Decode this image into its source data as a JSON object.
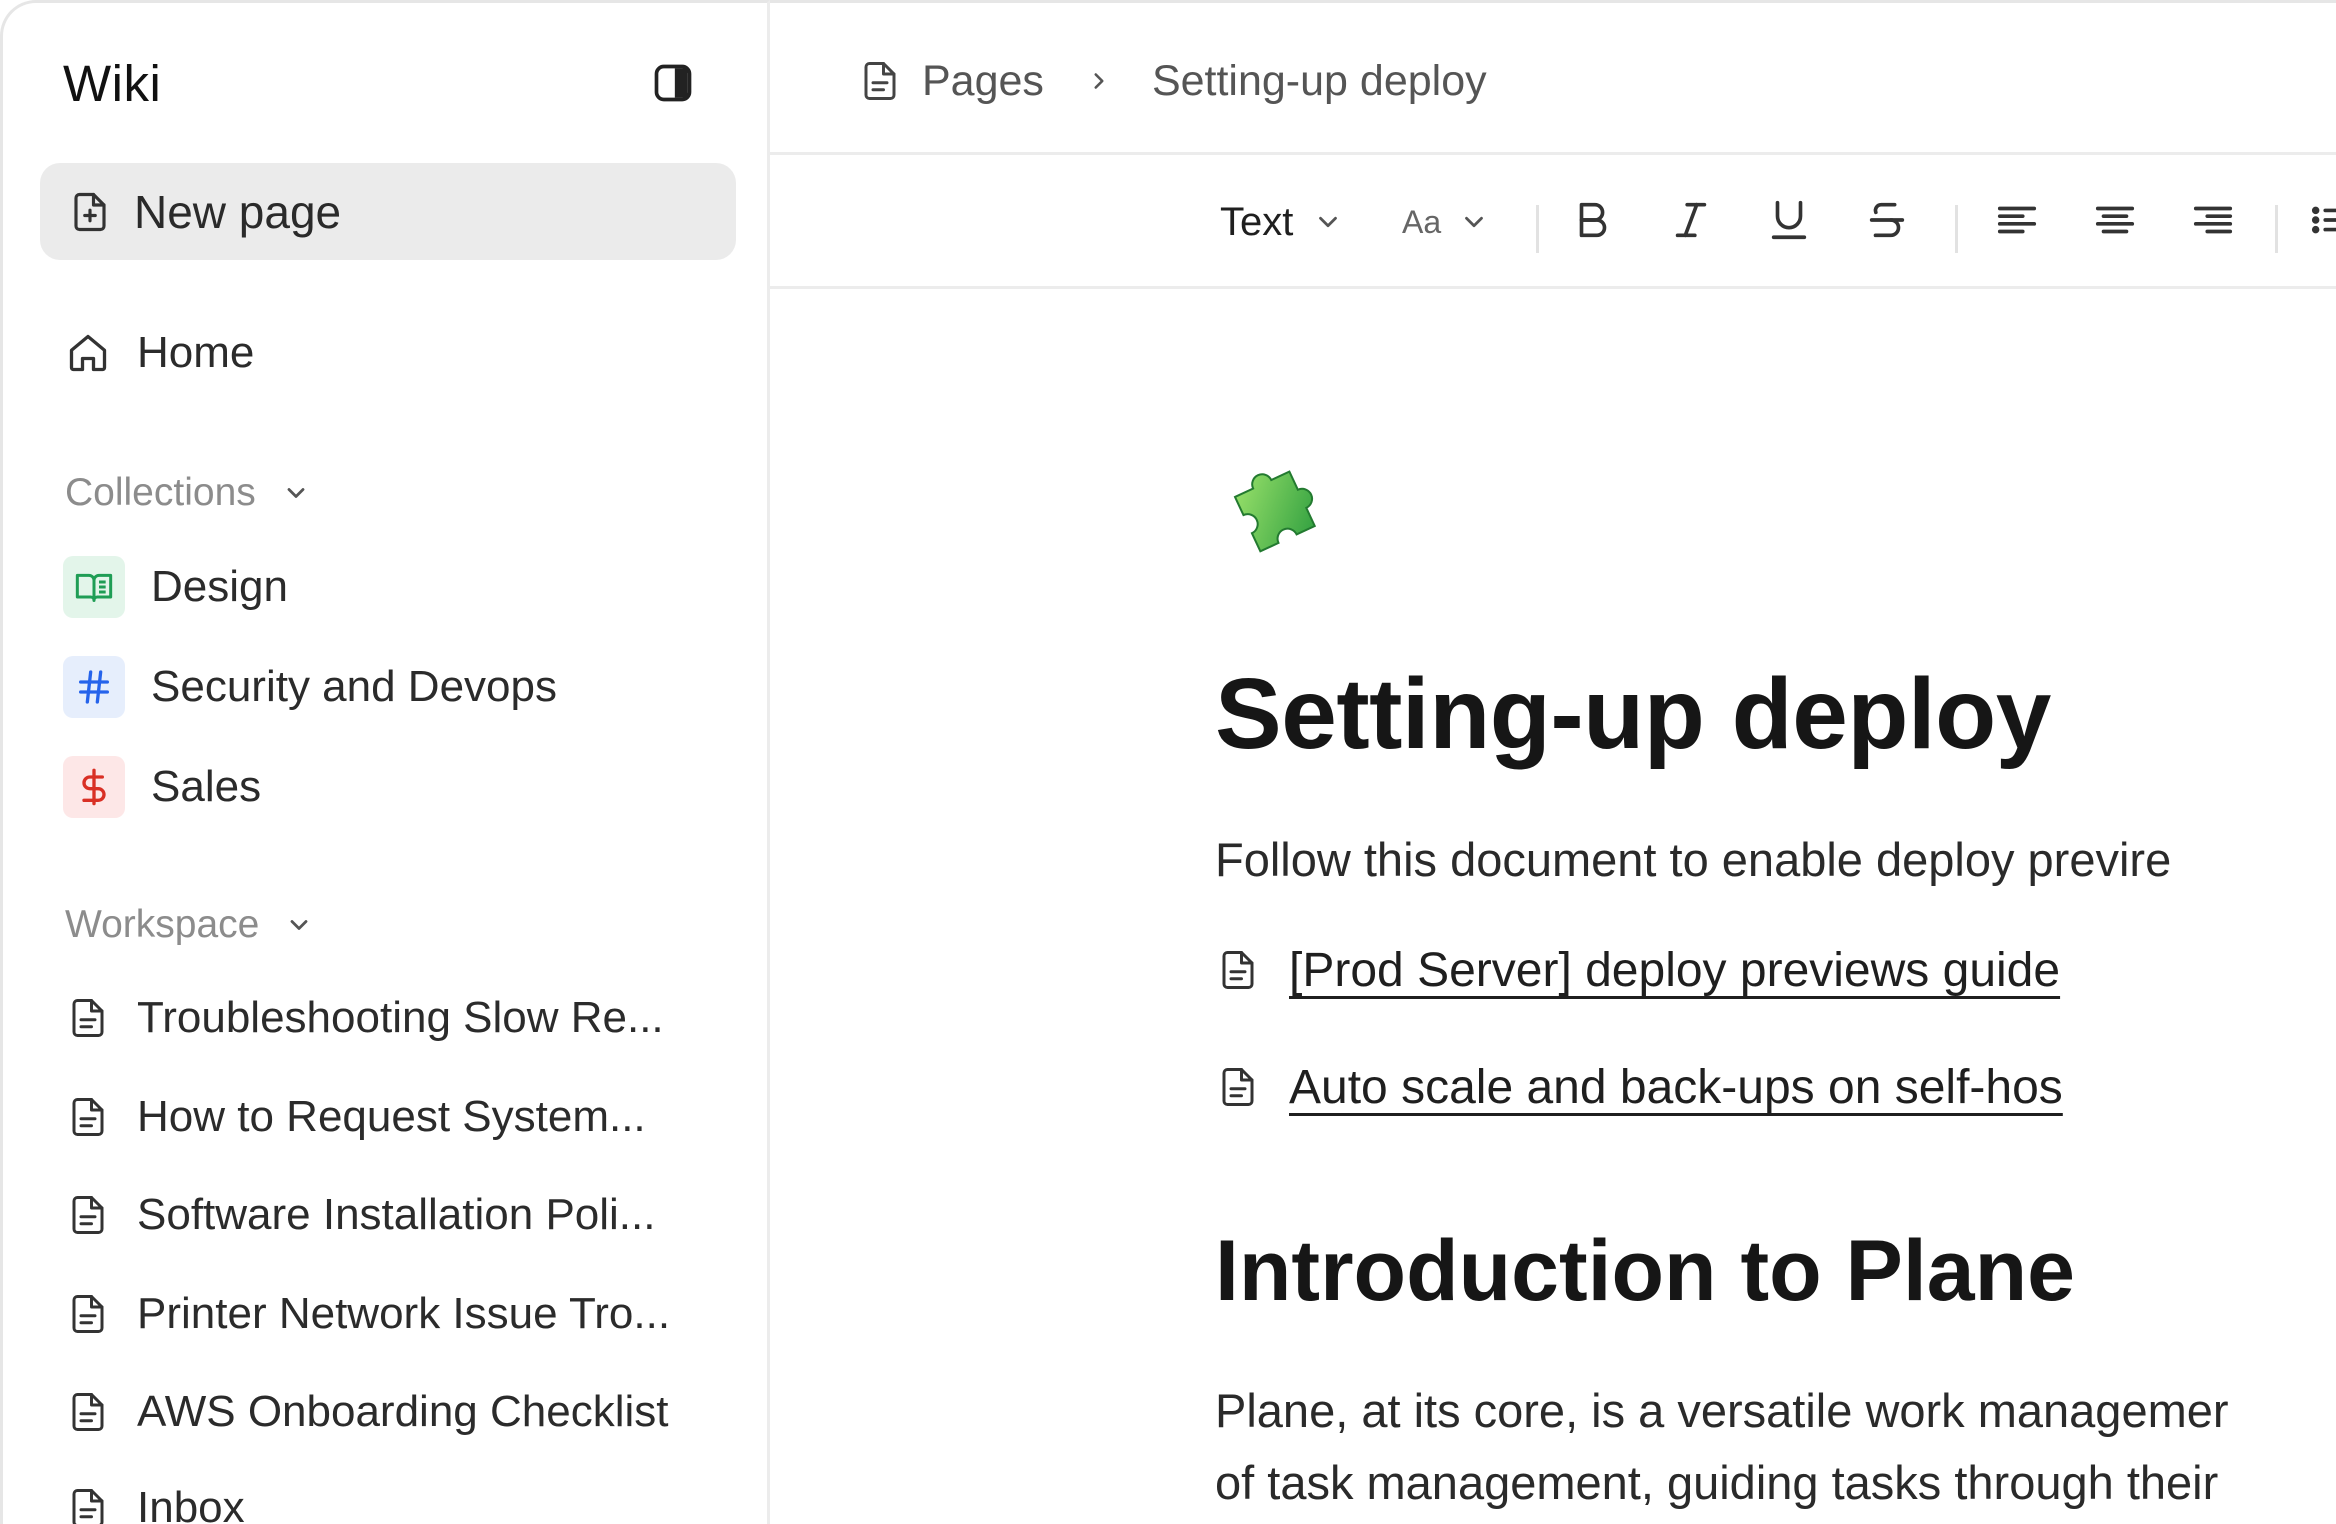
{
  "sidebar": {
    "app_title": "Wiki",
    "toggle_icon": "sidebar-toggle-icon",
    "new_page_label": "New page",
    "home_label": "Home",
    "collections": {
      "heading": "Collections",
      "items": [
        {
          "label": "Design",
          "icon": "book-open-icon",
          "color": "#1f9d55",
          "bg": "#e3f5ea"
        },
        {
          "label": "Security and Devops",
          "icon": "hash-icon",
          "color": "#2563eb",
          "bg": "#e6eefc"
        },
        {
          "label": "Sales",
          "icon": "dollar-icon",
          "color": "#d93025",
          "bg": "#fde7e7"
        }
      ]
    },
    "workspace": {
      "heading": "Workspace",
      "items": [
        {
          "label": "Troubleshooting Slow Re..."
        },
        {
          "label": "How to Request System..."
        },
        {
          "label": "Software Installation Poli..."
        },
        {
          "label": "Printer Network Issue Tro..."
        },
        {
          "label": "AWS Onboarding Checklist"
        },
        {
          "label": "Inbox"
        }
      ]
    }
  },
  "breadcrumb": {
    "root": "Pages",
    "current": "Setting-up deploy"
  },
  "toolbar": {
    "text_style": "Text",
    "font_size": "Aa"
  },
  "document": {
    "icon": "puzzle-piece-icon",
    "title": "Setting-up deploy",
    "description": "Follow this document to enable deploy previre",
    "links": [
      {
        "label": "[Prod Server] deploy previews guide"
      },
      {
        "label": "Auto scale and back-ups on self-hos"
      }
    ],
    "section_heading": "Introduction to Plane",
    "paragraph_lines": [
      "Plane, at its core, is a versatile work managemer",
      "of task management, guiding tasks through their"
    ]
  },
  "colors": {
    "accent_green": "#1f9d55",
    "accent_blue": "#2563eb",
    "accent_red": "#d93025"
  }
}
